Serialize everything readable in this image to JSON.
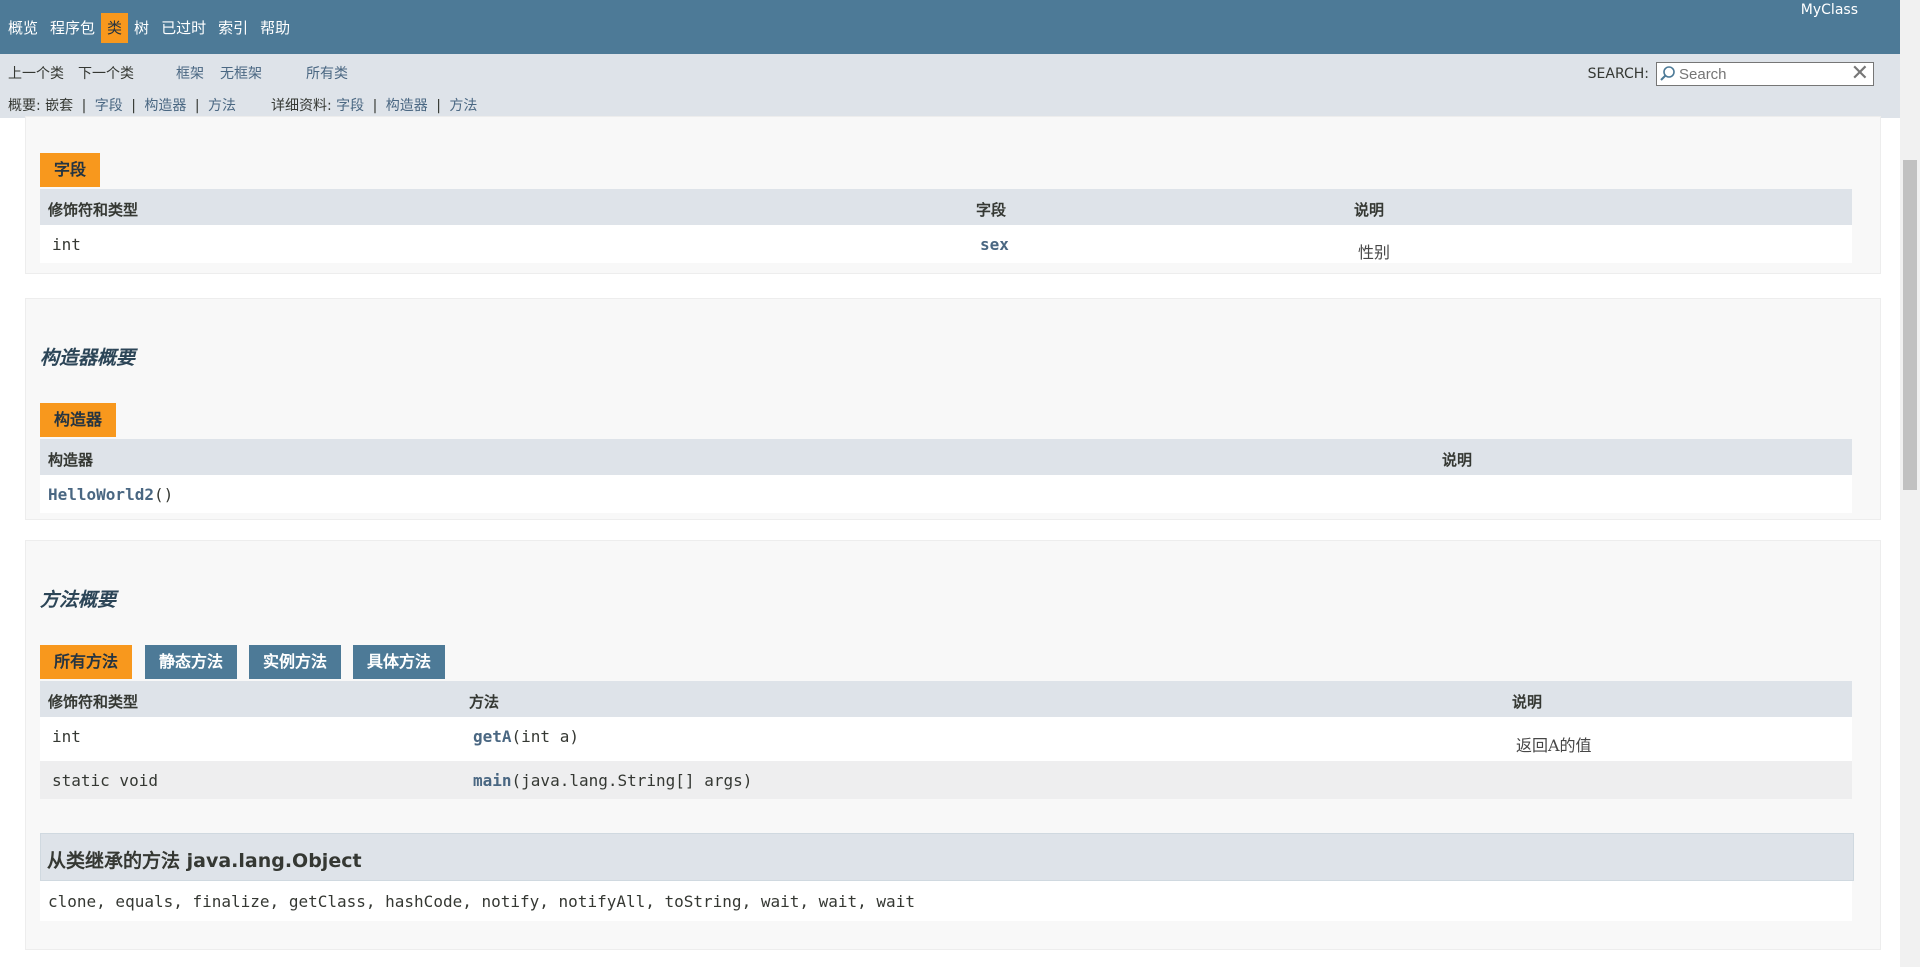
{
  "topnav": {
    "items": [
      "概览",
      "程序包",
      "类",
      "树",
      "已过时",
      "索引",
      "帮助"
    ],
    "active": "类",
    "brand": "MyClass"
  },
  "subnav": {
    "prev": "上一个类",
    "next": "下一个类",
    "frames": "框架",
    "noframes": "无框架",
    "allclasses": "所有类",
    "summary_label": "概要: 嵌套",
    "summary_links": [
      "字段",
      "构造器",
      "方法"
    ],
    "detail_label": "详细资料:",
    "detail_links": [
      "字段",
      "构造器",
      "方法"
    ],
    "separator": "|",
    "search_label": "SEARCH:",
    "search_placeholder": "Search"
  },
  "fields": {
    "caption": "字段",
    "headers": [
      "修饰符和类型",
      "字段",
      "说明"
    ],
    "rows": [
      {
        "type": "int",
        "name": "sex",
        "desc": "性别"
      }
    ]
  },
  "constructors": {
    "title": "构造器概要",
    "caption": "构造器",
    "headers": [
      "构造器",
      "说明"
    ],
    "rows": [
      {
        "name": "HelloWorld2",
        "params": "()"
      }
    ]
  },
  "methods": {
    "title": "方法概要",
    "tabs": [
      "所有方法",
      "静态方法",
      "实例方法",
      "具体方法"
    ],
    "active_tab": "所有方法",
    "headers": [
      "修饰符和类型",
      "方法",
      "说明"
    ],
    "rows": [
      {
        "type": "int",
        "name": "getA",
        "params": "(int a)",
        "desc": "返回A的值"
      },
      {
        "type": "static void",
        "name": "main",
        "params": "(java.lang.String[] args)",
        "desc": ""
      }
    ],
    "inherited_title": "从类继承的方法 java.lang.Object",
    "inherited_list": "clone, equals, finalize, getClass, hashCode, notify, notifyAll, toString, wait, wait, wait"
  },
  "colors": {
    "nav_bg": "#4d7a97",
    "active_tab": "#f8981d",
    "subnav_bg": "#dee3e9",
    "link": "#4a6782"
  }
}
